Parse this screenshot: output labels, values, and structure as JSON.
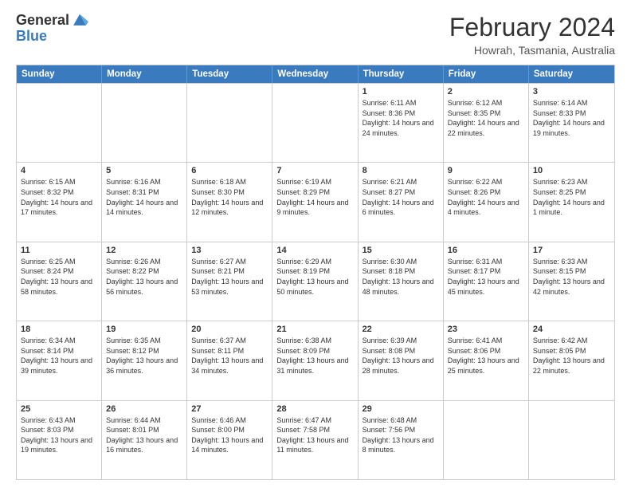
{
  "logo": {
    "general": "General",
    "blue": "Blue"
  },
  "header": {
    "month_year": "February 2024",
    "location": "Howrah, Tasmania, Australia"
  },
  "days_of_week": [
    "Sunday",
    "Monday",
    "Tuesday",
    "Wednesday",
    "Thursday",
    "Friday",
    "Saturday"
  ],
  "weeks": [
    [
      {
        "day": "",
        "info": ""
      },
      {
        "day": "",
        "info": ""
      },
      {
        "day": "",
        "info": ""
      },
      {
        "day": "",
        "info": ""
      },
      {
        "day": "1",
        "info": "Sunrise: 6:11 AM\nSunset: 8:36 PM\nDaylight: 14 hours and 24 minutes."
      },
      {
        "day": "2",
        "info": "Sunrise: 6:12 AM\nSunset: 8:35 PM\nDaylight: 14 hours and 22 minutes."
      },
      {
        "day": "3",
        "info": "Sunrise: 6:14 AM\nSunset: 8:33 PM\nDaylight: 14 hours and 19 minutes."
      }
    ],
    [
      {
        "day": "4",
        "info": "Sunrise: 6:15 AM\nSunset: 8:32 PM\nDaylight: 14 hours and 17 minutes."
      },
      {
        "day": "5",
        "info": "Sunrise: 6:16 AM\nSunset: 8:31 PM\nDaylight: 14 hours and 14 minutes."
      },
      {
        "day": "6",
        "info": "Sunrise: 6:18 AM\nSunset: 8:30 PM\nDaylight: 14 hours and 12 minutes."
      },
      {
        "day": "7",
        "info": "Sunrise: 6:19 AM\nSunset: 8:29 PM\nDaylight: 14 hours and 9 minutes."
      },
      {
        "day": "8",
        "info": "Sunrise: 6:21 AM\nSunset: 8:27 PM\nDaylight: 14 hours and 6 minutes."
      },
      {
        "day": "9",
        "info": "Sunrise: 6:22 AM\nSunset: 8:26 PM\nDaylight: 14 hours and 4 minutes."
      },
      {
        "day": "10",
        "info": "Sunrise: 6:23 AM\nSunset: 8:25 PM\nDaylight: 14 hours and 1 minute."
      }
    ],
    [
      {
        "day": "11",
        "info": "Sunrise: 6:25 AM\nSunset: 8:24 PM\nDaylight: 13 hours and 58 minutes."
      },
      {
        "day": "12",
        "info": "Sunrise: 6:26 AM\nSunset: 8:22 PM\nDaylight: 13 hours and 56 minutes."
      },
      {
        "day": "13",
        "info": "Sunrise: 6:27 AM\nSunset: 8:21 PM\nDaylight: 13 hours and 53 minutes."
      },
      {
        "day": "14",
        "info": "Sunrise: 6:29 AM\nSunset: 8:19 PM\nDaylight: 13 hours and 50 minutes."
      },
      {
        "day": "15",
        "info": "Sunrise: 6:30 AM\nSunset: 8:18 PM\nDaylight: 13 hours and 48 minutes."
      },
      {
        "day": "16",
        "info": "Sunrise: 6:31 AM\nSunset: 8:17 PM\nDaylight: 13 hours and 45 minutes."
      },
      {
        "day": "17",
        "info": "Sunrise: 6:33 AM\nSunset: 8:15 PM\nDaylight: 13 hours and 42 minutes."
      }
    ],
    [
      {
        "day": "18",
        "info": "Sunrise: 6:34 AM\nSunset: 8:14 PM\nDaylight: 13 hours and 39 minutes."
      },
      {
        "day": "19",
        "info": "Sunrise: 6:35 AM\nSunset: 8:12 PM\nDaylight: 13 hours and 36 minutes."
      },
      {
        "day": "20",
        "info": "Sunrise: 6:37 AM\nSunset: 8:11 PM\nDaylight: 13 hours and 34 minutes."
      },
      {
        "day": "21",
        "info": "Sunrise: 6:38 AM\nSunset: 8:09 PM\nDaylight: 13 hours and 31 minutes."
      },
      {
        "day": "22",
        "info": "Sunrise: 6:39 AM\nSunset: 8:08 PM\nDaylight: 13 hours and 28 minutes."
      },
      {
        "day": "23",
        "info": "Sunrise: 6:41 AM\nSunset: 8:06 PM\nDaylight: 13 hours and 25 minutes."
      },
      {
        "day": "24",
        "info": "Sunrise: 6:42 AM\nSunset: 8:05 PM\nDaylight: 13 hours and 22 minutes."
      }
    ],
    [
      {
        "day": "25",
        "info": "Sunrise: 6:43 AM\nSunset: 8:03 PM\nDaylight: 13 hours and 19 minutes."
      },
      {
        "day": "26",
        "info": "Sunrise: 6:44 AM\nSunset: 8:01 PM\nDaylight: 13 hours and 16 minutes."
      },
      {
        "day": "27",
        "info": "Sunrise: 6:46 AM\nSunset: 8:00 PM\nDaylight: 13 hours and 14 minutes."
      },
      {
        "day": "28",
        "info": "Sunrise: 6:47 AM\nSunset: 7:58 PM\nDaylight: 13 hours and 11 minutes."
      },
      {
        "day": "29",
        "info": "Sunrise: 6:48 AM\nSunset: 7:56 PM\nDaylight: 13 hours and 8 minutes."
      },
      {
        "day": "",
        "info": ""
      },
      {
        "day": "",
        "info": ""
      }
    ]
  ]
}
